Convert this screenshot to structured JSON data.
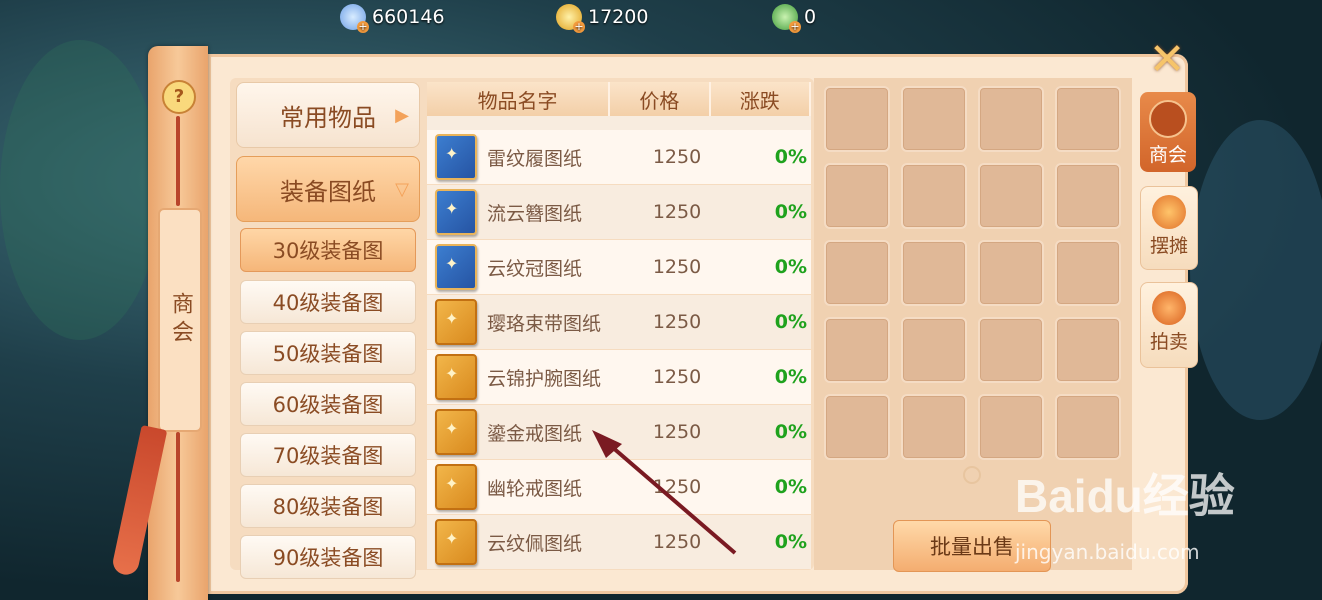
{
  "currencies": [
    {
      "icon": "silver-coin-icon",
      "value": "660146"
    },
    {
      "icon": "gold-ingot-icon",
      "value": "17200"
    },
    {
      "icon": "jade-coin-icon",
      "value": "0"
    }
  ],
  "left_panel": {
    "help": "?",
    "tab_label": "商会"
  },
  "categories": {
    "common": "常用物品",
    "equip": "装备图纸",
    "sub_items": [
      "30级装备图",
      "40级装备图",
      "50级装备图",
      "60级装备图",
      "70级装备图",
      "80级装备图",
      "90级装备图"
    ]
  },
  "table": {
    "headers": [
      "物品名字",
      "价格",
      "涨跌"
    ],
    "rows": [
      {
        "name": "雷纹履图纸",
        "price": "1250",
        "change": "0%",
        "book": "blue"
      },
      {
        "name": "流云簪图纸",
        "price": "1250",
        "change": "0%",
        "book": "blue"
      },
      {
        "name": "云纹冠图纸",
        "price": "1250",
        "change": "0%",
        "book": "blue"
      },
      {
        "name": "璎珞束带图纸",
        "price": "1250",
        "change": "0%",
        "book": "gold"
      },
      {
        "name": "云锦护腕图纸",
        "price": "1250",
        "change": "0%",
        "book": "gold"
      },
      {
        "name": "鎏金戒图纸",
        "price": "1250",
        "change": "0%",
        "book": "gold"
      },
      {
        "name": "幽轮戒图纸",
        "price": "1250",
        "change": "0%",
        "book": "gold"
      },
      {
        "name": "云纹佩图纸",
        "price": "1250",
        "change": "0%",
        "book": "gold"
      }
    ]
  },
  "batch_sell": "批量出售",
  "right_tabs": [
    "商会",
    "摆摊",
    "拍卖"
  ],
  "watermark": {
    "logo": "Baidu经验",
    "url": "jingyan.baidu.com"
  },
  "colors": {
    "accent": "#d2652a",
    "positive": "#1fa21d",
    "text": "#8a4b23"
  }
}
